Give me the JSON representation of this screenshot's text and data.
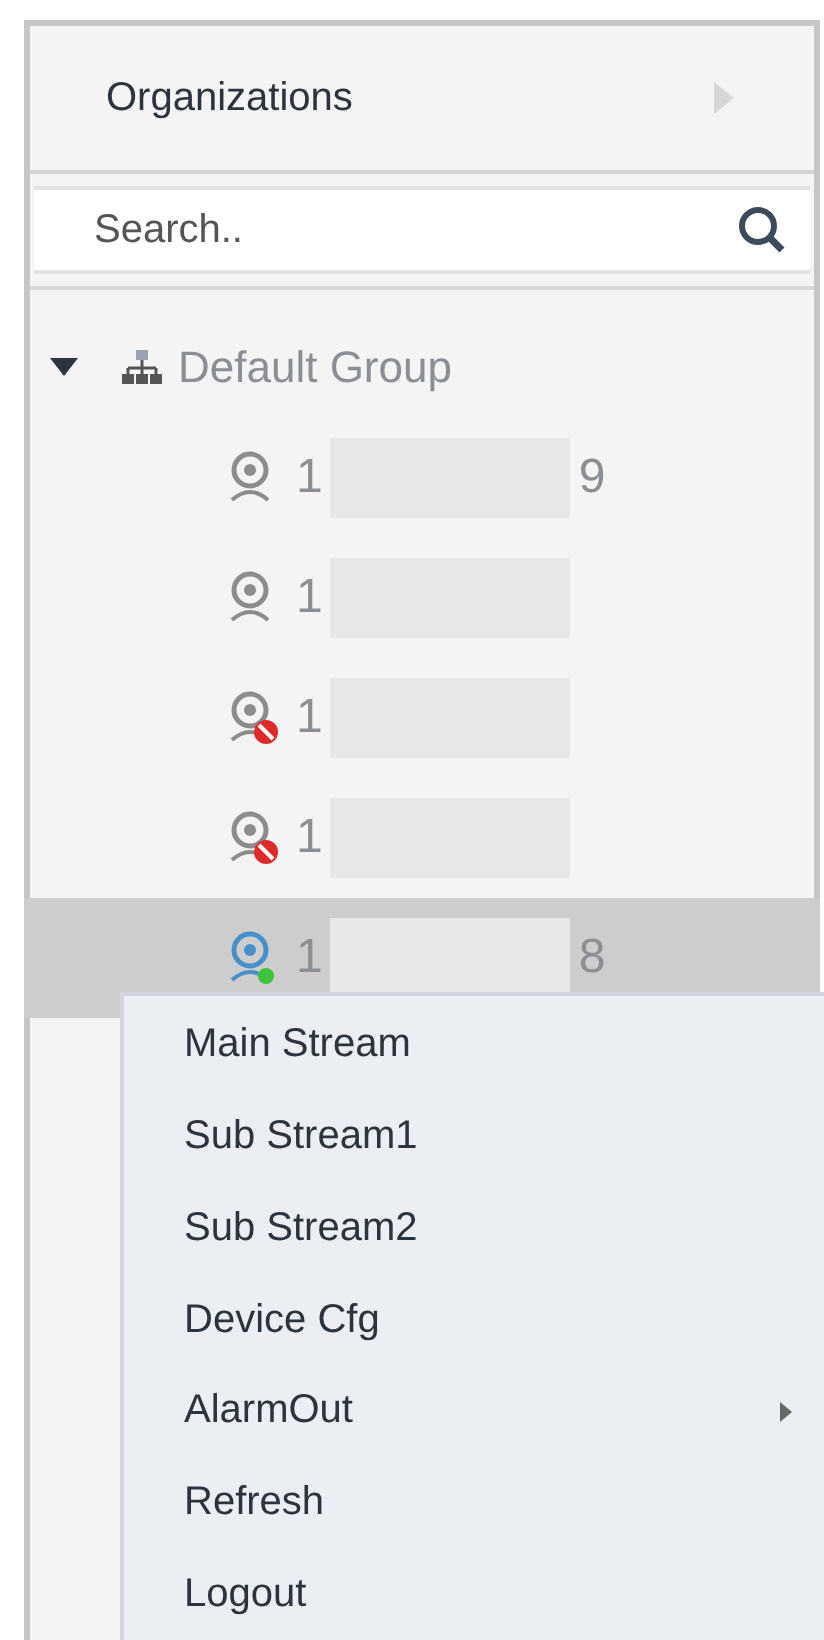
{
  "header": {
    "title": "Organizations"
  },
  "search": {
    "placeholder": "Search.."
  },
  "tree": {
    "label": "Default Group",
    "expanded": true,
    "children": [
      {
        "kind": "online",
        "prefix": "1",
        "suffix": "9",
        "selected": false
      },
      {
        "kind": "online",
        "prefix": "1",
        "selected": false
      },
      {
        "kind": "offline",
        "prefix": "1",
        "selected": false
      },
      {
        "kind": "offline",
        "prefix": "1",
        "selected": false
      },
      {
        "kind": "active",
        "prefix": "1",
        "suffix": "8",
        "selected": true
      }
    ]
  },
  "context_menu": [
    {
      "label": "Main Stream",
      "submenu": false
    },
    {
      "label": "Sub Stream1",
      "submenu": false
    },
    {
      "label": "Sub Stream2",
      "submenu": false
    },
    {
      "label": "Device Cfg",
      "submenu": false
    },
    {
      "label": "AlarmOut",
      "submenu": true
    },
    {
      "label": "Refresh",
      "submenu": false
    },
    {
      "label": "Logout",
      "submenu": false
    }
  ]
}
